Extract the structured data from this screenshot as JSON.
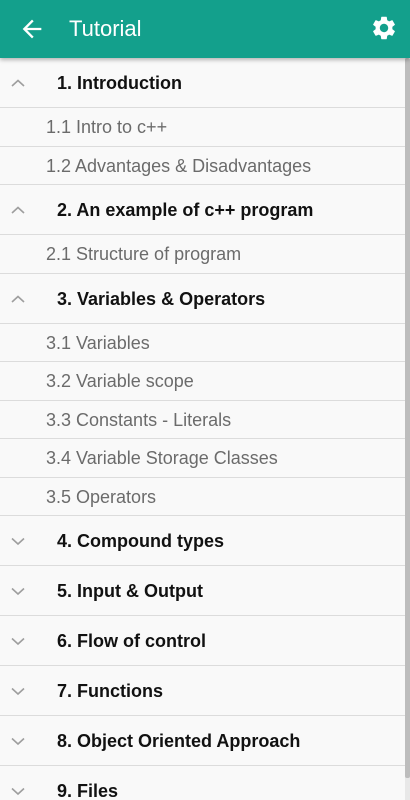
{
  "appbar": {
    "title": "Tutorial",
    "back_icon": "arrow-back-icon",
    "settings_icon": "gear-icon",
    "color": "#13a08c"
  },
  "sections": [
    {
      "label": "1. Introduction",
      "expanded": true,
      "items": [
        "1.1 Intro to c++",
        "1.2 Advantages & Disadvantages"
      ]
    },
    {
      "label": "2. An example of c++ program",
      "expanded": true,
      "items": [
        "2.1 Structure of program"
      ]
    },
    {
      "label": "3. Variables & Operators",
      "expanded": true,
      "items": [
        "3.1 Variables",
        "3.2 Variable scope",
        "3.3 Constants - Literals",
        "3.4 Variable Storage Classes",
        "3.5 Operators"
      ]
    },
    {
      "label": "4. Compound types",
      "expanded": false,
      "items": []
    },
    {
      "label": "5. Input & Output",
      "expanded": false,
      "items": []
    },
    {
      "label": "6. Flow of control",
      "expanded": false,
      "items": []
    },
    {
      "label": "7. Functions",
      "expanded": false,
      "items": []
    },
    {
      "label": "8. Object Oriented Approach",
      "expanded": false,
      "items": []
    },
    {
      "label": "9. Files",
      "expanded": false,
      "items": []
    }
  ]
}
